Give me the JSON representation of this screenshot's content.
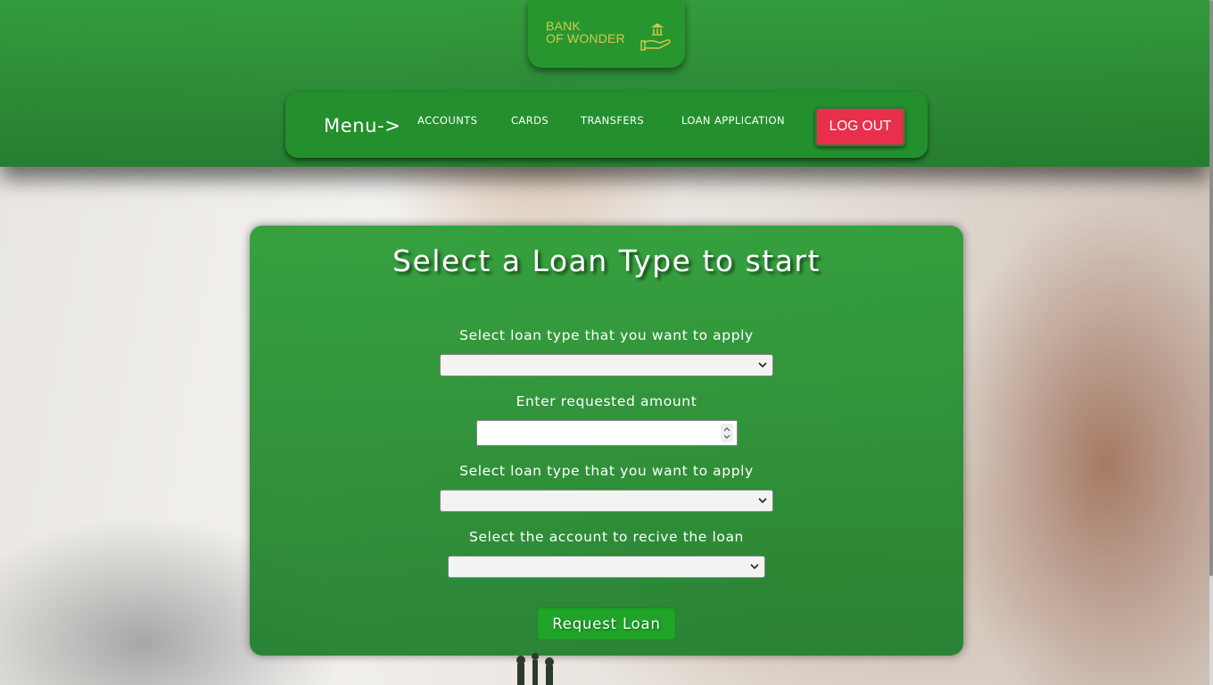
{
  "brand": {
    "logo_line1": "BANK",
    "logo_line2": "OF WONDER",
    "logo_icon": "bank-hand-icon",
    "color_gold": "#d6c94a"
  },
  "nav": {
    "menu_label": "Menu->",
    "items": [
      {
        "label": "ACCOUNTS"
      },
      {
        "label": "CARDS"
      },
      {
        "label": "TRANSFERS"
      },
      {
        "label": "LOAN APPLICATION"
      }
    ],
    "logout_label": "LOG OUT"
  },
  "form": {
    "title": "Select a Loan Type to start",
    "fields": [
      {
        "label": "Select loan type that you want to apply",
        "type": "select",
        "value": ""
      },
      {
        "label": "Enter requested amount",
        "type": "number",
        "value": ""
      },
      {
        "label": "Select loan type that you want to apply",
        "type": "select",
        "value": ""
      },
      {
        "label": "Select the account to recive the loan",
        "type": "select",
        "value": ""
      }
    ],
    "submit_label": "Request Loan"
  },
  "colors": {
    "primary_green": "#27962f",
    "logout_red": "#e8304c",
    "submit_green": "#1fa328"
  }
}
